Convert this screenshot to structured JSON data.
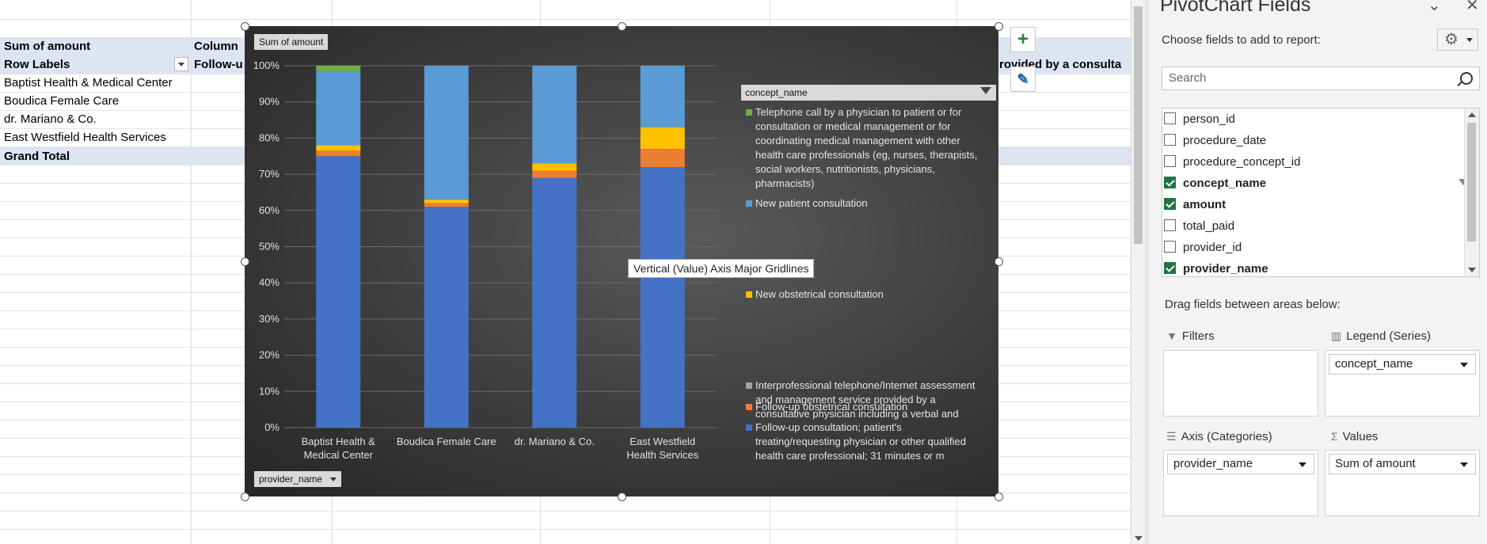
{
  "sheet": {
    "cells": {
      "a1": "Sum of amount",
      "b1": "Column",
      "a2": "Row Labels",
      "b2": "Follow-u",
      "rows": [
        "Baptist Health & Medical Center",
        "Boudica Female Care",
        "dr. Mariano & Co.",
        "East Westfield Health Services"
      ],
      "grand_total": "Grand Total",
      "right_header": "rovided by a consulta"
    }
  },
  "chart": {
    "values_chip": "Sum of amount",
    "axis_chip": "provider_name",
    "legend_title": "concept_name",
    "tooltip": "Vertical (Value) Axis Major Gridlines",
    "side_buttons": {
      "add": "+",
      "style": "✎"
    }
  },
  "chart_data": {
    "type": "bar",
    "stacked": "100%",
    "ylim": [
      0,
      100
    ],
    "yticks": [
      "0%",
      "10%",
      "20%",
      "30%",
      "40%",
      "50%",
      "60%",
      "70%",
      "80%",
      "90%",
      "100%"
    ],
    "categories": [
      "Baptist Health & Medical Center",
      "Boudica Female Care",
      "dr. Mariano & Co.",
      "East Westfield Health Services"
    ],
    "series": [
      {
        "name": "Follow-up consultation; patient's treating/requesting physician or other qualified health care professional; 31 minutes or m",
        "color": "#4472c4",
        "values": [
          75,
          61,
          69,
          72
        ]
      },
      {
        "name": "Follow-up obstetrical consultation",
        "color": "#ed7d31",
        "values": [
          1.5,
          1,
          2,
          5
        ]
      },
      {
        "name": "Interprofessional telephone/Internet assessment and management service provided by a consultative physician including a verbal and",
        "color": "#a5a5a5",
        "values": [
          0,
          0,
          0,
          0
        ]
      },
      {
        "name": "New obstetrical consultation",
        "color": "#ffc000",
        "values": [
          1.5,
          1,
          2,
          6
        ]
      },
      {
        "name": "New patient consultation",
        "color": "#5b9bd5",
        "values": [
          20.5,
          37,
          27,
          17
        ]
      },
      {
        "name": "Telephone call by a physician to patient or for consultation or medical management or for coordinating medical management with other health care professionals (eg, nurses, therapists, social workers, nutritionists, physicians, pharmacists)",
        "color": "#70ad47",
        "values": [
          1.5,
          0,
          0,
          0
        ]
      }
    ],
    "legend_placement": "right",
    "grid": true
  },
  "pane": {
    "title": "PivotChart Fields",
    "subtitle": "Choose fields to add to report:",
    "search_placeholder": "Search",
    "fields": [
      {
        "name": "person_id",
        "checked": false
      },
      {
        "name": "procedure_date",
        "checked": false
      },
      {
        "name": "procedure_concept_id",
        "checked": false
      },
      {
        "name": "concept_name",
        "checked": true
      },
      {
        "name": "amount",
        "checked": true
      },
      {
        "name": "total_paid",
        "checked": false
      },
      {
        "name": "provider_id",
        "checked": false
      },
      {
        "name": "provider_name",
        "checked": true
      }
    ],
    "drag_label": "Drag fields between areas below:",
    "areas": {
      "filters": "Filters",
      "legend": "Legend (Series)",
      "legend_value": "concept_name",
      "axis": "Axis (Categories)",
      "axis_value": "provider_name",
      "values": "Values",
      "values_value": "Sum of amount"
    }
  }
}
